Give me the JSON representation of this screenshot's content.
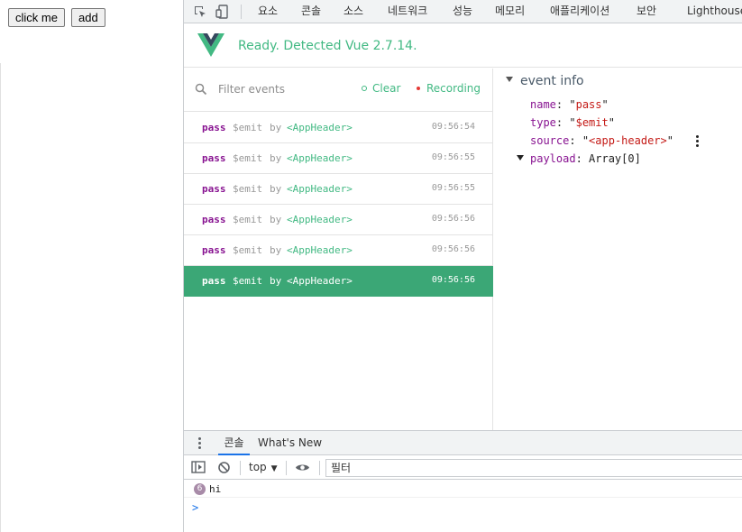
{
  "page": {
    "buttons": [
      {
        "label": "click me"
      },
      {
        "label": "add"
      }
    ]
  },
  "devtools": {
    "tabs": [
      "요소",
      "콘솔",
      "소스",
      "네트워크",
      "성능",
      "메모리",
      "애플리케이션",
      "보안",
      "Lighthouse"
    ]
  },
  "vue": {
    "status": "Ready. Detected Vue 2.7.14.",
    "accent": "#42b983",
    "filter_placeholder": "Filter events",
    "clear_label": "Clear",
    "recording_label": "Recording",
    "events": [
      {
        "name": "pass",
        "type": "$emit",
        "by": "by",
        "component": "<AppHeader>",
        "time": "09:56:54"
      },
      {
        "name": "pass",
        "type": "$emit",
        "by": "by",
        "component": "<AppHeader>",
        "time": "09:56:55"
      },
      {
        "name": "pass",
        "type": "$emit",
        "by": "by",
        "component": "<AppHeader>",
        "time": "09:56:55"
      },
      {
        "name": "pass",
        "type": "$emit",
        "by": "by",
        "component": "<AppHeader>",
        "time": "09:56:56"
      },
      {
        "name": "pass",
        "type": "$emit",
        "by": "by",
        "component": "<AppHeader>",
        "time": "09:56:56"
      },
      {
        "name": "pass",
        "type": "$emit",
        "by": "by",
        "component": "<AppHeader>",
        "time": "09:56:56",
        "selected": true
      }
    ],
    "info": {
      "title": "event info",
      "name_key": "name",
      "name_val": "pass",
      "type_key": "type",
      "type_val": "$emit",
      "source_key": "source",
      "source_val": "<app-header>",
      "payload_key": "payload",
      "payload_val": "Array[0]"
    }
  },
  "drawer": {
    "tabs": [
      "콘솔",
      "What's New"
    ],
    "context": "top",
    "filter_value": "필터",
    "log": {
      "count": "6",
      "text": "hi"
    },
    "prompt": ">"
  }
}
